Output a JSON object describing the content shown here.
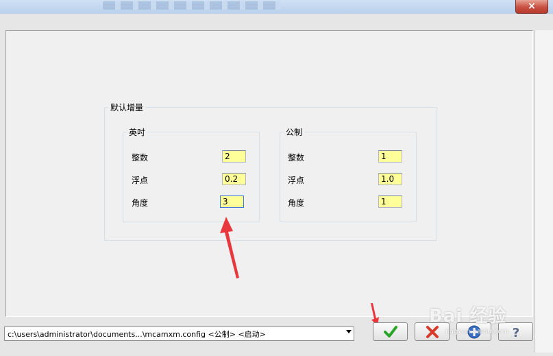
{
  "window": {
    "close_label": "×"
  },
  "default_increments": {
    "title": "默认增量",
    "inch": {
      "title": "英吋",
      "integer_label": "整数",
      "integer_value": "2",
      "float_label": "浮点",
      "float_value": "0.2",
      "angle_label": "角度",
      "angle_value": "3"
    },
    "metric": {
      "title": "公制",
      "integer_label": "整数",
      "integer_value": "1",
      "float_label": "浮点",
      "float_value": "1.0",
      "angle_label": "角度",
      "angle_value": "1"
    }
  },
  "status": {
    "config_path": "c:\\users\\administrator\\documents...\\mcamxm.config <公制> <启动>"
  },
  "buttons": {
    "ok_icon": "checkmark-icon",
    "cancel_icon": "x-icon",
    "add_icon": "plus-icon",
    "help_icon": "question-icon"
  },
  "watermark": {
    "brand": "Bai 经验",
    "url": "jingyan.baidu.com"
  },
  "colors": {
    "input_bg": "#ffff99",
    "annotation_arrow": "#e8383d",
    "ok_green": "#2aa52a",
    "cancel_red": "#d63a2a"
  }
}
